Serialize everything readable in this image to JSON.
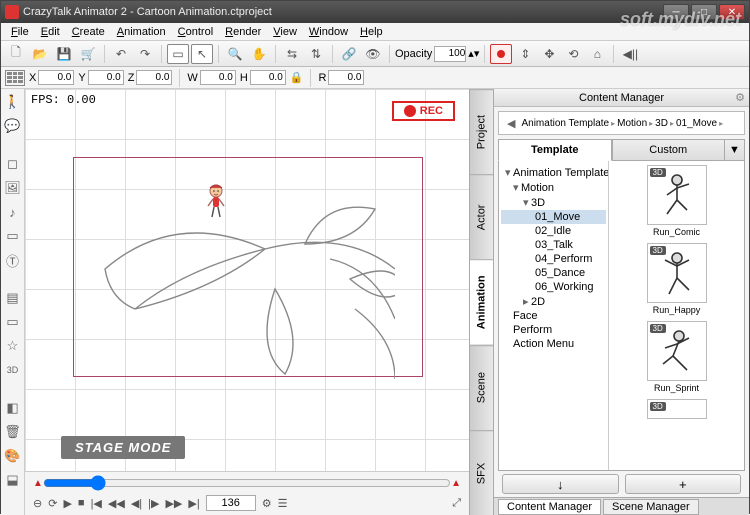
{
  "window": {
    "title": "CrazyTalk Animator 2  - Cartoon Animation.ctproject"
  },
  "menus": [
    "File",
    "Edit",
    "Create",
    "Animation",
    "Control",
    "Render",
    "View",
    "Window",
    "Help"
  ],
  "toolbar": {
    "opacity_label": "Opacity",
    "opacity_value": "100"
  },
  "coords": {
    "X": "0.0",
    "Y": "0.0",
    "Z": "0.0",
    "W": "0.0",
    "H": "0.0",
    "R": "0.0"
  },
  "fps": "FPS: 0.00",
  "rec_label": "REC",
  "stage_mode": "STAGE MODE",
  "transport": {
    "frame": "136"
  },
  "side_tabs": [
    "Project",
    "Actor",
    "Animation",
    "Scene",
    "SFX"
  ],
  "content_manager": {
    "title": "Content Manager",
    "breadcrumb": [
      "Animation Template",
      "Motion",
      "3D",
      "01_Move"
    ],
    "tabs": {
      "template": "Template",
      "custom": "Custom"
    },
    "tree": {
      "root": "Animation Template",
      "motion": "Motion",
      "three_d": "3D",
      "items3d": [
        "01_Move",
        "02_Idle",
        "03_Talk",
        "04_Perform",
        "05_Dance",
        "06_Working"
      ],
      "two_d": "2D",
      "extra": [
        "Face",
        "Perform",
        "Action Menu"
      ]
    },
    "thumbs": [
      {
        "badge": "3D",
        "label": "Run_Comic"
      },
      {
        "badge": "3D",
        "label": "Run_Happy"
      },
      {
        "badge": "3D",
        "label": "Run_Sprint"
      },
      {
        "badge": "3D",
        "label": ""
      }
    ],
    "foot": {
      "down": "↓",
      "plus": "+"
    }
  },
  "bottom_tabs": {
    "cm": "Content Manager",
    "sm": "Scene Manager"
  }
}
